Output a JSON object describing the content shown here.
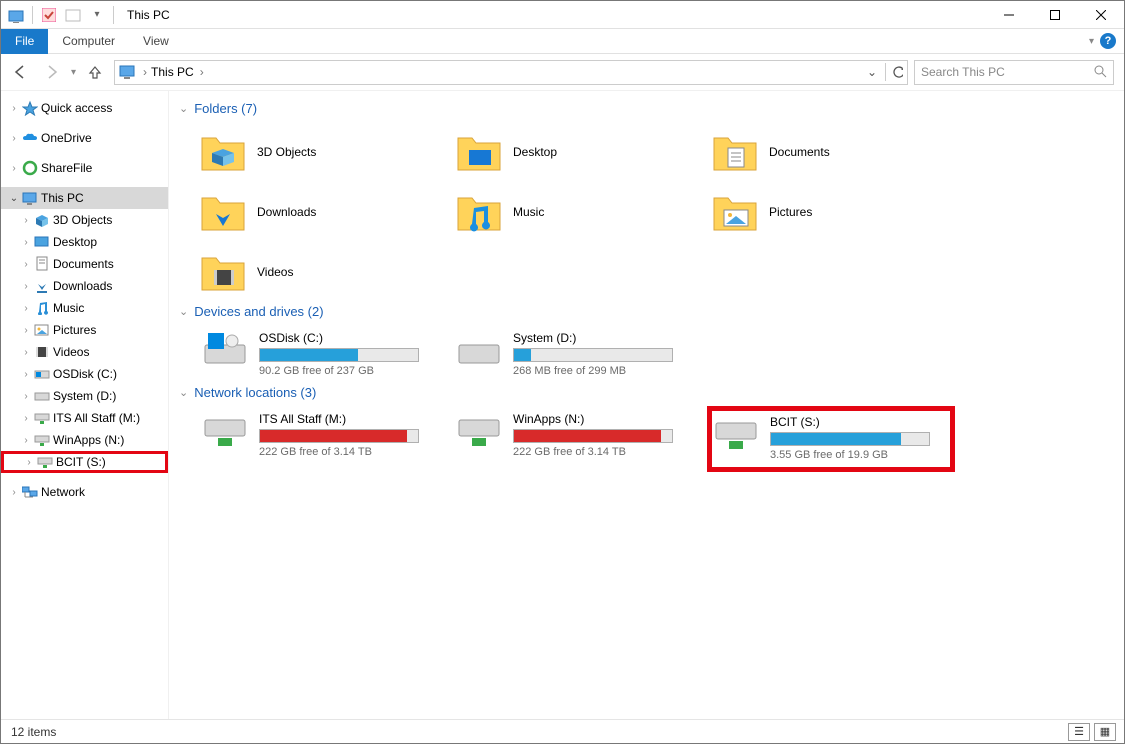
{
  "window": {
    "title": "This PC",
    "search_placeholder": "Search This PC"
  },
  "ribbon": {
    "file": "File",
    "tabs": [
      "Computer",
      "View"
    ]
  },
  "breadcrumb": {
    "root": "This PC"
  },
  "sidebar": {
    "quick_access": "Quick access",
    "onedrive": "OneDrive",
    "sharefile": "ShareFile",
    "this_pc": "This PC",
    "items": [
      "3D Objects",
      "Desktop",
      "Documents",
      "Downloads",
      "Music",
      "Pictures",
      "Videos",
      "OSDisk (C:)",
      "System (D:)",
      "ITS All Staff (M:)",
      "WinApps (N:)",
      "BCIT (S:)"
    ],
    "network": "Network"
  },
  "groups": {
    "folders": {
      "label": "Folders (7)"
    },
    "drives": {
      "label": "Devices and drives (2)"
    },
    "network": {
      "label": "Network locations (3)"
    }
  },
  "folders": [
    "3D Objects",
    "Desktop",
    "Documents",
    "Downloads",
    "Music",
    "Pictures",
    "Videos"
  ],
  "drives": [
    {
      "name": "OSDisk (C:)",
      "free": "90.2 GB free of 237 GB",
      "fill_pct": 62,
      "color": "#26a0da"
    },
    {
      "name": "System (D:)",
      "free": "268 MB free of 299 MB",
      "fill_pct": 11,
      "color": "#26a0da"
    }
  ],
  "net_locations": [
    {
      "name": "ITS All Staff (M:)",
      "free": "222 GB free of 3.14 TB",
      "fill_pct": 93,
      "color": "#d82a2a"
    },
    {
      "name": "WinApps (N:)",
      "free": "222 GB free of 3.14 TB",
      "fill_pct": 93,
      "color": "#d82a2a"
    },
    {
      "name": "BCIT (S:)",
      "free": "3.55 GB free of 19.9 GB",
      "fill_pct": 82,
      "color": "#26a0da"
    }
  ],
  "statusbar": {
    "count": "12 items"
  }
}
